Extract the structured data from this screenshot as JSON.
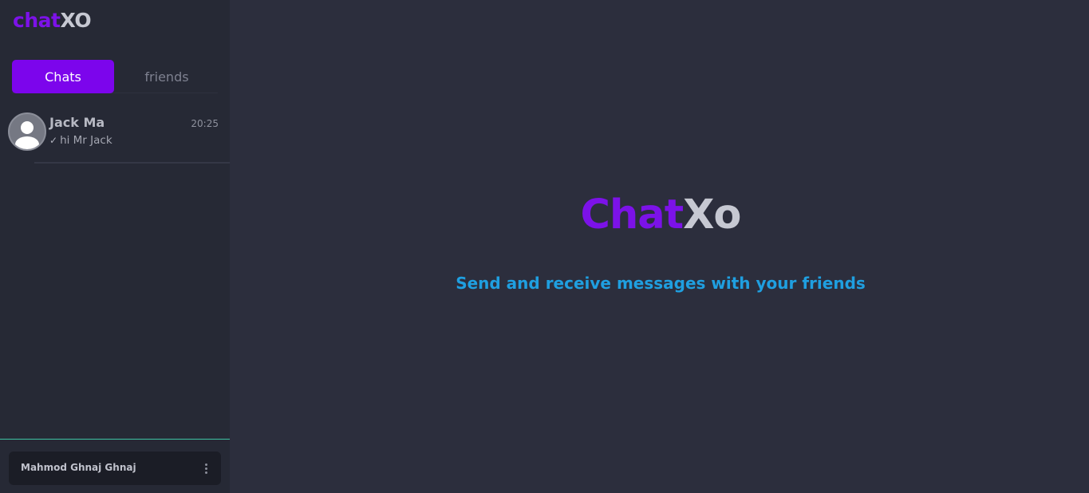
{
  "app": {
    "logo_part1": "chat",
    "logo_part2": "XO"
  },
  "tabs": [
    {
      "label": "Chats",
      "active": true
    },
    {
      "label": "friends",
      "active": false
    }
  ],
  "chats": [
    {
      "name": "Jack Ma",
      "time": "20:25",
      "preview": "hi Mr Jack",
      "status_icon": "check-icon"
    }
  ],
  "user": {
    "name": "Mahmod Ghnaj Ghnaj"
  },
  "welcome": {
    "brand_part1": "Chat",
    "brand_part2": "Xo",
    "tagline": "Send and receive messages with your friends"
  },
  "colors": {
    "accent": "#7c05ec",
    "sidebar_bg": "#262935",
    "main_bg": "#2c2e3d",
    "tagline": "#1f9fe0",
    "divider": "#3ec3a2"
  }
}
